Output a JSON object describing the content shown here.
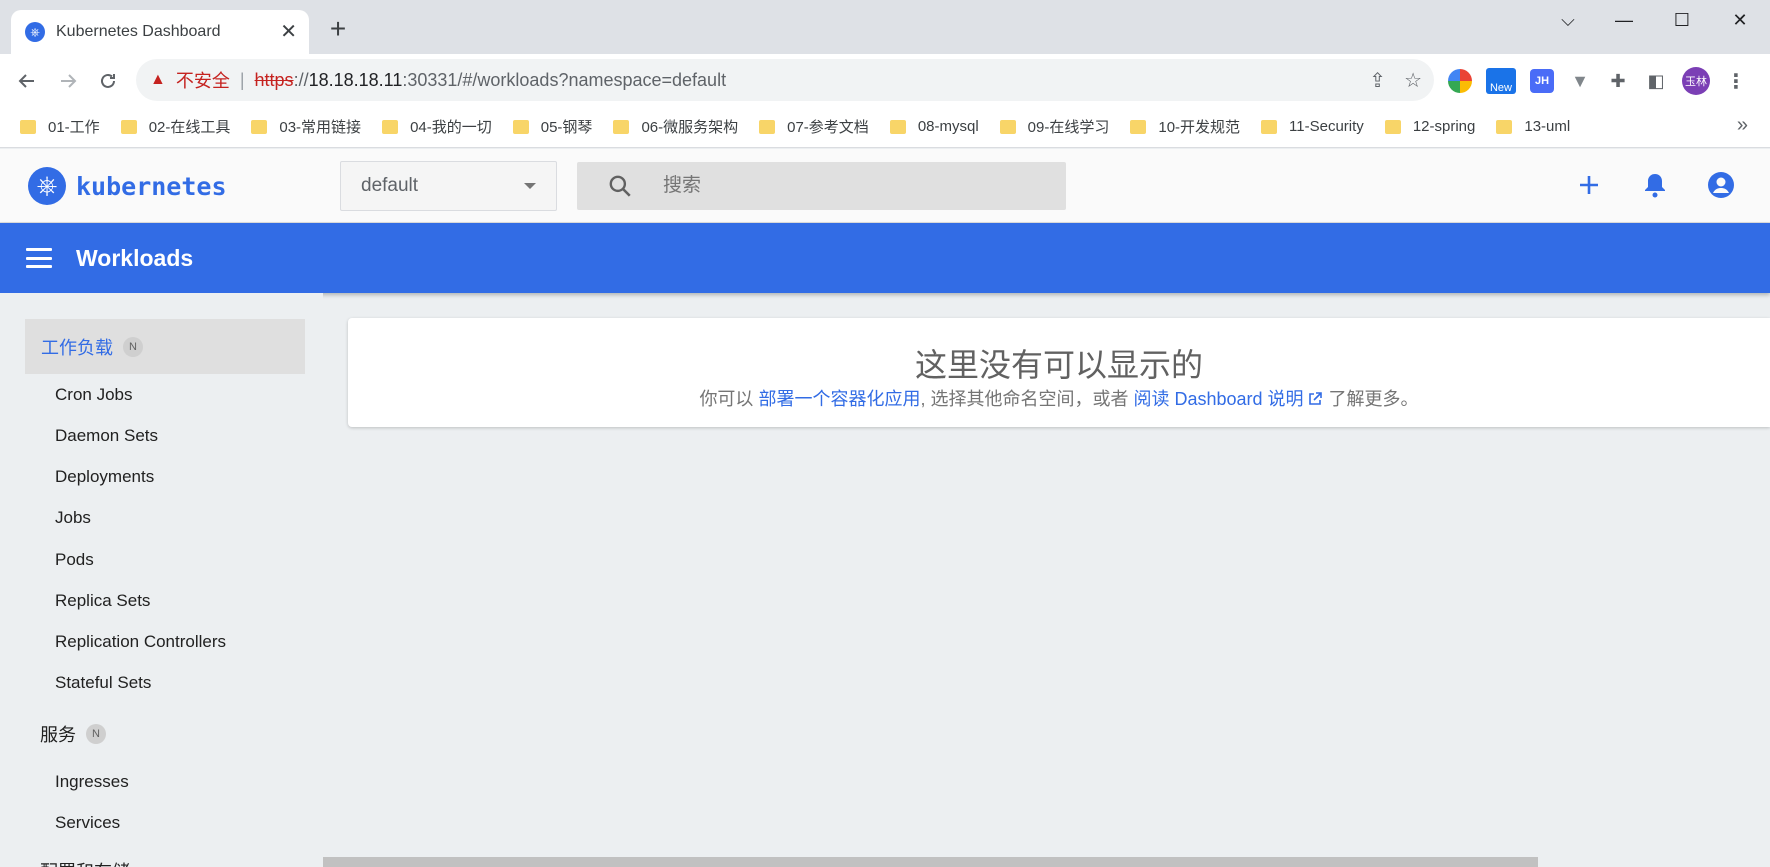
{
  "browser": {
    "tab_title": "Kubernetes Dashboard",
    "tab_close": "✕",
    "new_tab": "+",
    "window_controls": {
      "dropdown": "⌵",
      "minimize": "—",
      "maximize": "☐",
      "close": "✕"
    },
    "address": {
      "security_label": "不安全",
      "url_scheme": "https",
      "url_sep": "://",
      "url_host": "18.18.18.11",
      "url_rest": ":30331/#/workloads?namespace=default"
    },
    "extensions": {
      "new_badge": "New",
      "jh": "JH",
      "profile": "玉林"
    },
    "bookmarks": [
      "01-工作",
      "02-在线工具",
      "03-常用链接",
      "04-我的一切",
      "05-钢琴",
      "06-微服务架构",
      "07-参考文档",
      "08-mysql",
      "09-在线学习",
      "10-开发规范",
      "11-Security",
      "12-spring",
      "13-uml"
    ],
    "bookmarks_more": "»"
  },
  "app": {
    "brand": "kubernetes",
    "namespace": {
      "value": "default"
    },
    "search": {
      "placeholder": "搜索"
    },
    "toolbar_title": "Workloads",
    "colors": {
      "primary": "#326ce5",
      "background": "#eceff1"
    }
  },
  "sidebar": {
    "workloads": {
      "label": "工作负载",
      "badge": "N"
    },
    "workload_items": [
      "Cron Jobs",
      "Daemon Sets",
      "Deployments",
      "Jobs",
      "Pods",
      "Replica Sets",
      "Replication Controllers",
      "Stateful Sets"
    ],
    "services": {
      "label": "服务",
      "badge": "N"
    },
    "service_items": [
      "Ingresses",
      "Services"
    ],
    "config": {
      "label": "配置和存储"
    }
  },
  "empty_state": {
    "title": "这里没有可以显示的",
    "text_prefix": "你可以 ",
    "link_deploy": "部署一个容器化应用",
    "text_middle": ", 选择其他命名空间，或者 ",
    "link_docs": "阅读 Dashboard 说明",
    "text_suffix": " 了解更多。"
  }
}
